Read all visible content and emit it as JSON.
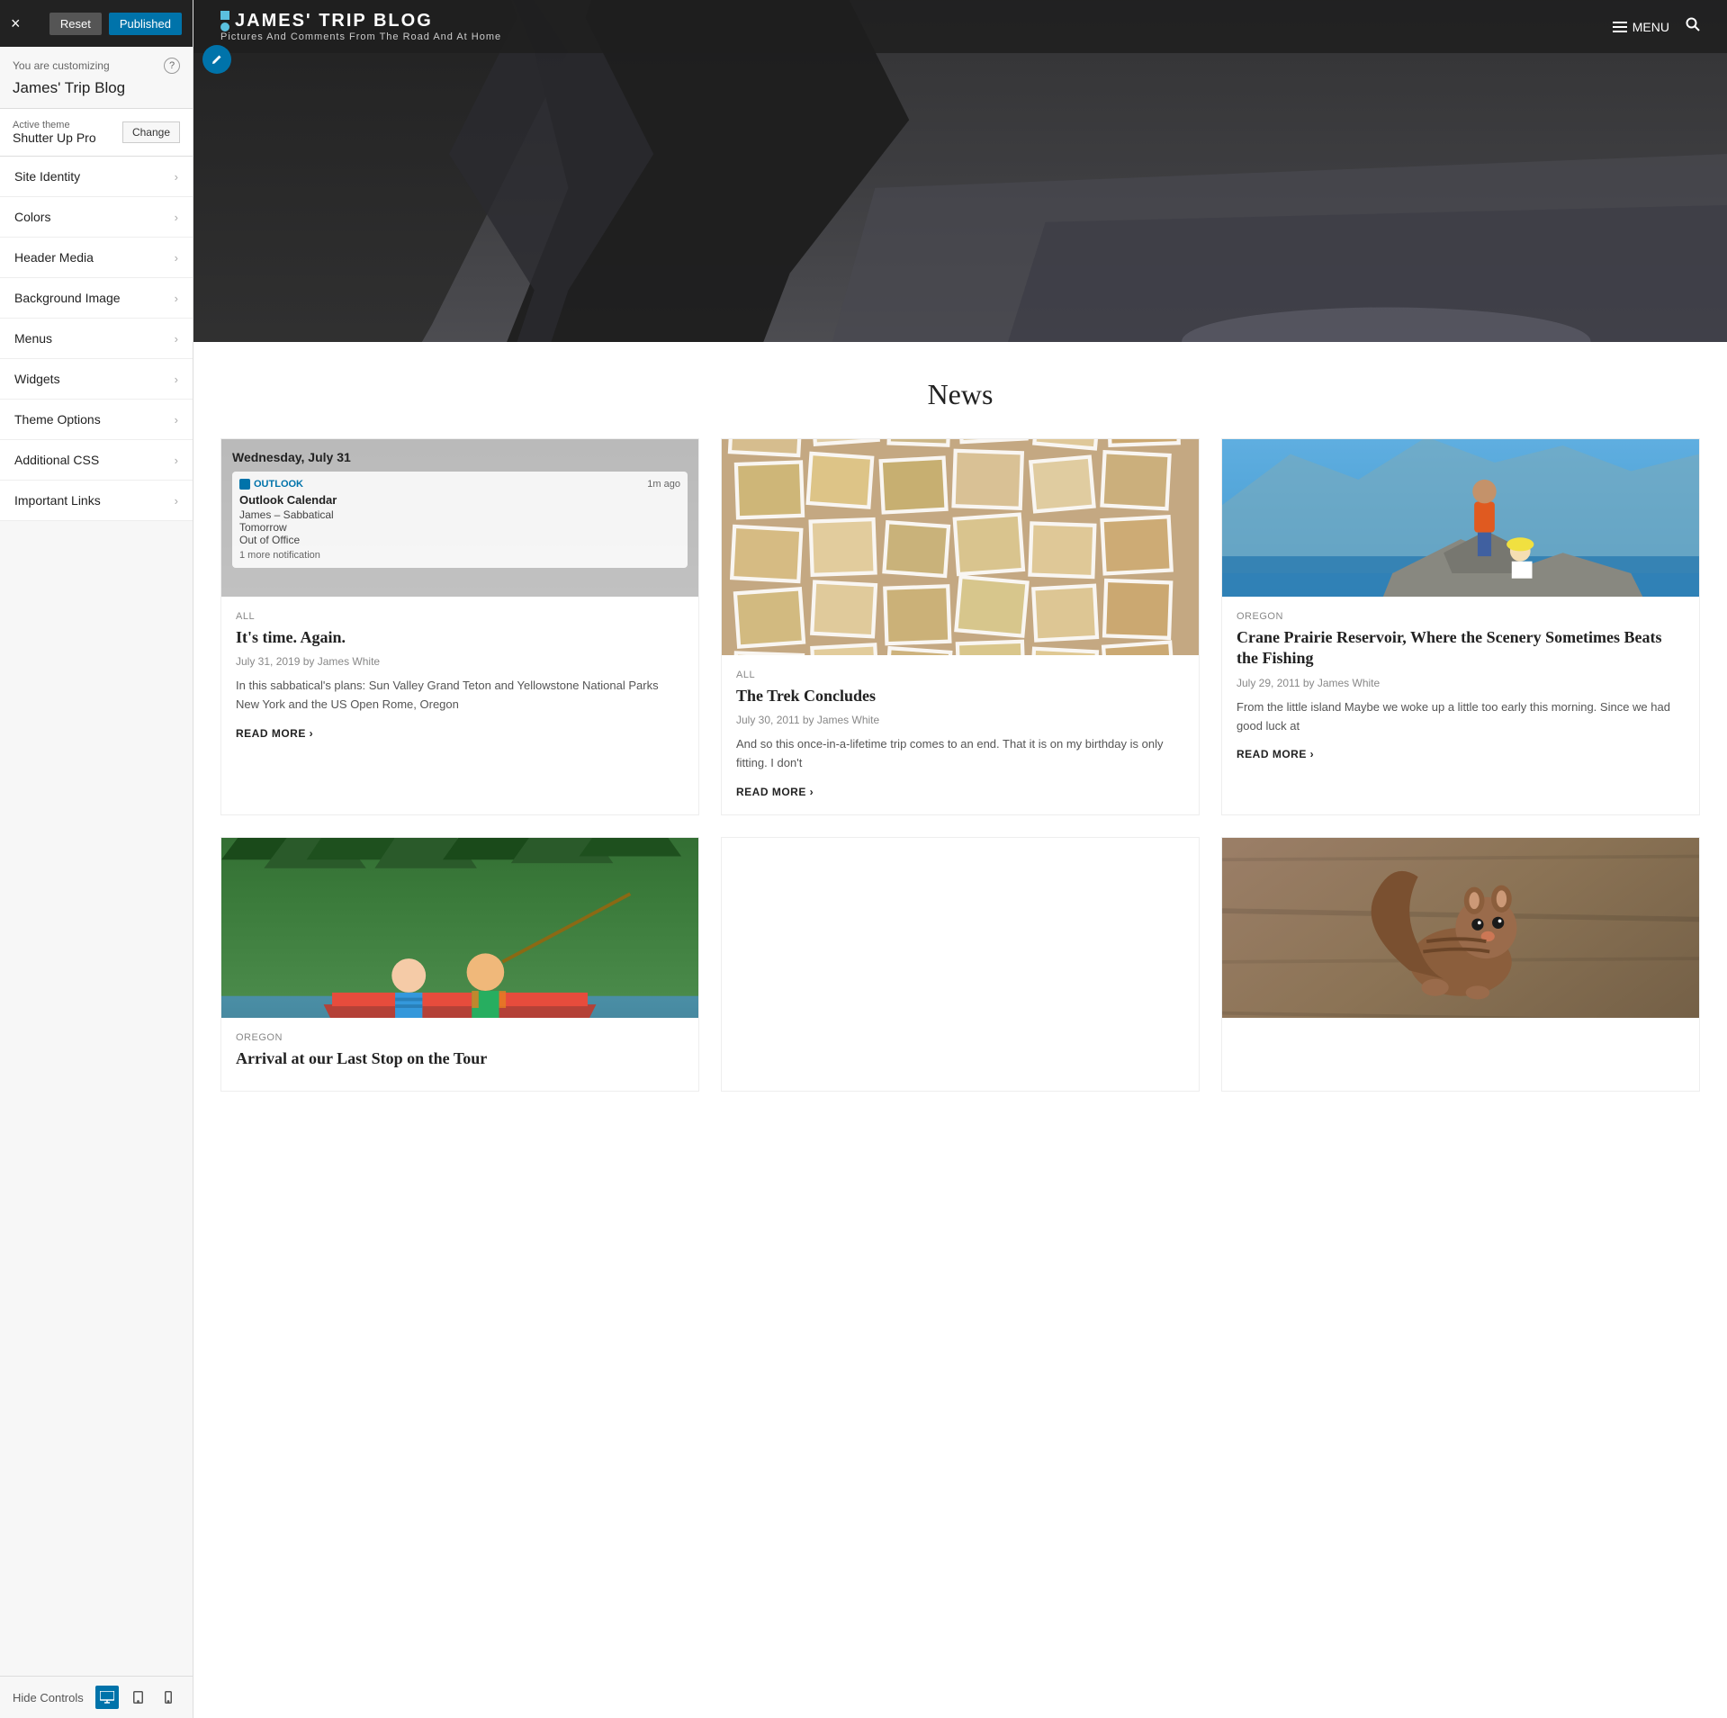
{
  "panel": {
    "close_label": "×",
    "reset_label": "Reset",
    "published_label": "Published",
    "customizing_text": "You are customizing",
    "help_label": "?",
    "site_title": "James' Trip Blog",
    "active_theme_label": "Active theme",
    "active_theme_name": "Shutter Up Pro",
    "change_label": "Change",
    "menu_items": [
      {
        "id": "site-identity",
        "label": "Site Identity"
      },
      {
        "id": "colors",
        "label": "Colors"
      },
      {
        "id": "header-media",
        "label": "Header Media"
      },
      {
        "id": "background-image",
        "label": "Background Image"
      },
      {
        "id": "menus",
        "label": "Menus"
      },
      {
        "id": "widgets",
        "label": "Widgets"
      },
      {
        "id": "theme-options",
        "label": "Theme Options"
      },
      {
        "id": "additional-css",
        "label": "Additional CSS"
      },
      {
        "id": "important-links",
        "label": "Important Links"
      }
    ],
    "hide_controls_label": "Hide Controls",
    "footer_devices": [
      "desktop",
      "tablet",
      "mobile"
    ]
  },
  "site": {
    "name": "JAMES' TRIP BLOG",
    "tagline": "Pictures And Comments From The Road And At Home",
    "nav_menu_label": "MENU",
    "news_section_title": "News"
  },
  "cards": [
    {
      "id": "its-time",
      "category": "All",
      "title": "It's time. Again.",
      "meta": "July 31, 2019 by James White",
      "excerpt": "In this sabbatical's plans: Sun Valley Grand Teton and Yellowstone National Parks New York and the US Open Rome, Oregon",
      "read_more": "READ MORE ›",
      "has_notification": true,
      "notification": {
        "date": "Wednesday, July 31",
        "app": "OUTLOOK",
        "time_ago": "1m ago",
        "calendar_label": "Outlook Calendar",
        "event_label": "James – Sabbatical",
        "event_sub": "Tomorrow",
        "event_status": "Out of Office",
        "more": "1 more notification"
      }
    },
    {
      "id": "trek-concludes",
      "category": "All",
      "title": "The Trek Concludes",
      "meta": "July 30, 2011 by James White",
      "excerpt": "And so this once-in-a-lifetime trip comes to an end. That it is on my birthday is only fitting. I don't",
      "read_more": "READ MORE ›",
      "has_collage": true
    },
    {
      "id": "crane-prairie",
      "category": "Oregon",
      "title": "Crane Prairie Reservoir, Where the Scenery Sometimes Beats the Fishing",
      "meta": "July 29, 2011 by James White",
      "excerpt": "From the little island Maybe we woke up a little too early this morning. Since we had good luck at",
      "read_more": "READ MORE ›",
      "has_rocks": true
    },
    {
      "id": "arrival",
      "category": "Oregon",
      "title": "Arrival at our Last Stop on the Tour",
      "meta": "",
      "excerpt": "",
      "read_more": "",
      "has_boat": true
    },
    {
      "id": "squirrel",
      "category": "",
      "title": "",
      "meta": "",
      "excerpt": "",
      "read_more": "",
      "has_squirrel": true
    }
  ]
}
